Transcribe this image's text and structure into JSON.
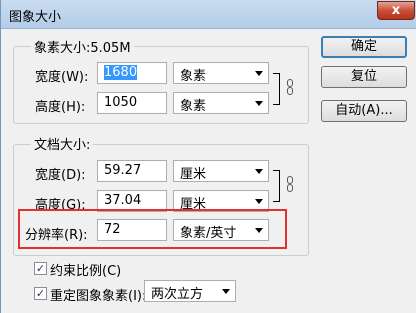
{
  "window": {
    "title": "图象大小",
    "close_label": "x"
  },
  "pixel_dimensions": {
    "legend": "象素大小:5.05M",
    "width_label": "宽度(W):",
    "width_value": "1680",
    "width_unit": "象素",
    "height_label": "高度(H):",
    "height_value": "1050",
    "height_unit": "象素"
  },
  "document_size": {
    "legend": "文档大小:",
    "width_label": "宽度(D):",
    "width_value": "59.27",
    "width_unit": "厘米",
    "height_label": "高度(G):",
    "height_value": "37.04",
    "height_unit": "厘米",
    "resolution_label": "分辨率(R):",
    "resolution_value": "72",
    "resolution_unit": "象素/英寸"
  },
  "buttons": {
    "ok": "确定",
    "reset": "复位",
    "auto": "自动(A)..."
  },
  "options": {
    "constrain_label": "约束比例(C)",
    "constrain_checked": true,
    "resample_label": "重定图象象素(I):",
    "resample_checked": true,
    "resample_method": "两次立方"
  },
  "colors": {
    "highlight": "#e03030",
    "title_bar": "#c9dcf0",
    "selection": "#3399ff"
  }
}
